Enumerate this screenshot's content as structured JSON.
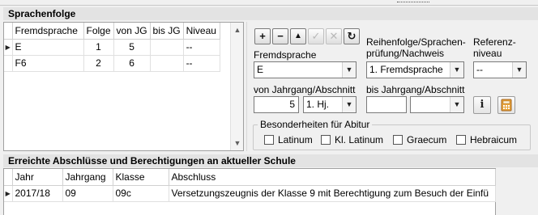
{
  "sprachenfolge": {
    "title": "Sprachenfolge",
    "columns": [
      "Fremdsprache",
      "Folge",
      "von JG",
      "bis JG",
      "Niveau"
    ],
    "rows": [
      {
        "indicator": "▶",
        "sprache": "E",
        "folge": "1",
        "von": "5",
        "bis": "",
        "niveau": "--"
      },
      {
        "indicator": "",
        "sprache": "F6",
        "folge": "2",
        "von": "6",
        "bis": "",
        "niveau": "--"
      }
    ]
  },
  "toolbar": {
    "add": "+",
    "remove": "−",
    "up": "▲",
    "confirm": "✓",
    "cancel": "✕",
    "refresh": "↻"
  },
  "detail": {
    "fremdsprache_label": "Fremdsprache",
    "fremdsprache_value": "E",
    "reihenfolge_label_1": "Reihenfolge/Sprachen-",
    "reihenfolge_label_2": "prüfung/Nachweis",
    "reihenfolge_value": "1. Fremdsprache",
    "referenz_label_1": "Referenz-",
    "referenz_label_2": "niveau",
    "referenz_value": "--",
    "von_label": "von Jahrgang/Abschnitt",
    "von_jahrgang": "5",
    "von_abschnitt": "1. Hj.",
    "bis_label": "bis Jahrgang/Abschnitt",
    "bis_jahrgang": "",
    "bis_abschnitt": "",
    "info_button": "i"
  },
  "abitur": {
    "title": "Besonderheiten für Abitur",
    "options": [
      "Latinum",
      "Kl. Latinum",
      "Graecum",
      "Hebraicum"
    ]
  },
  "abschluesse": {
    "title": "Erreichte Abschlüsse und Berechtigungen an aktueller Schule",
    "columns": [
      "Jahr",
      "Jahrgang",
      "Klasse",
      "Abschluss"
    ],
    "rows": [
      {
        "indicator": "▶",
        "jahr": "2017/18",
        "jahrgang": "09",
        "klasse": "09c",
        "abschluss": "Versetzungszeugnis der Klasse 9 mit Berechtigung zum Besuch der Einfü"
      }
    ]
  }
}
